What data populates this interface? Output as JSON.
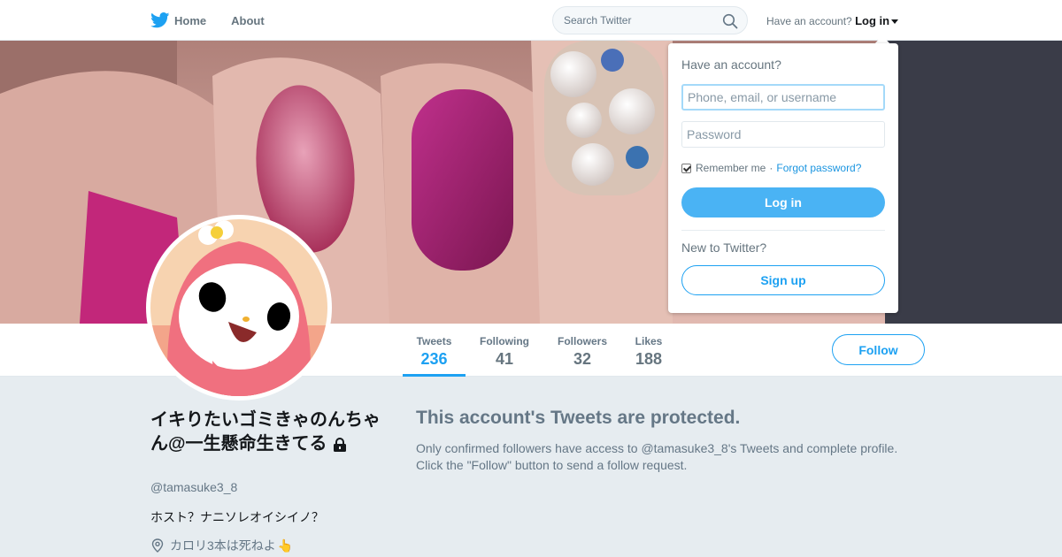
{
  "nav": {
    "home_label": "Home",
    "about_label": "About",
    "search_placeholder": "Search Twitter",
    "account_prompt": "Have an account?",
    "login_label": "Log in"
  },
  "profile_nav": {
    "stats": [
      {
        "label": "Tweets",
        "value": "236"
      },
      {
        "label": "Following",
        "value": "41"
      },
      {
        "label": "Followers",
        "value": "32"
      },
      {
        "label": "Likes",
        "value": "188"
      }
    ],
    "follow_label": "Follow"
  },
  "profile": {
    "name": "イキりたいゴミきゃのんちゃん@一生懸命生きてる",
    "screen_name": "@tamasuke3_8",
    "bio": "ホスト？ナニソレオイシイノ？",
    "location": "カロリ3本は死ねよ",
    "location_emoji": "👆"
  },
  "protected": {
    "title": "This account's Tweets are protected.",
    "line1": "Only confirmed followers have access to @tamasuke3_8's Tweets and complete profile.",
    "line2": "Click the \"Follow\" button to send a follow request."
  },
  "login_dropdown": {
    "title": "Have an account?",
    "username_placeholder": "Phone, email, or username",
    "password_placeholder": "Password",
    "remember_label": "Remember me",
    "separator": "·",
    "forgot_label": "Forgot password?",
    "login_button": "Log in",
    "new_prompt": "New to Twitter?",
    "signup_button": "Sign up"
  },
  "colors": {
    "accent": "#1da1f2",
    "login_button": "#4ab3f4",
    "background": "#e6ecf0"
  },
  "icons": [
    "twitter-bird-icon",
    "search-icon",
    "caret-down-icon",
    "lock-icon",
    "location-pin-icon"
  ]
}
